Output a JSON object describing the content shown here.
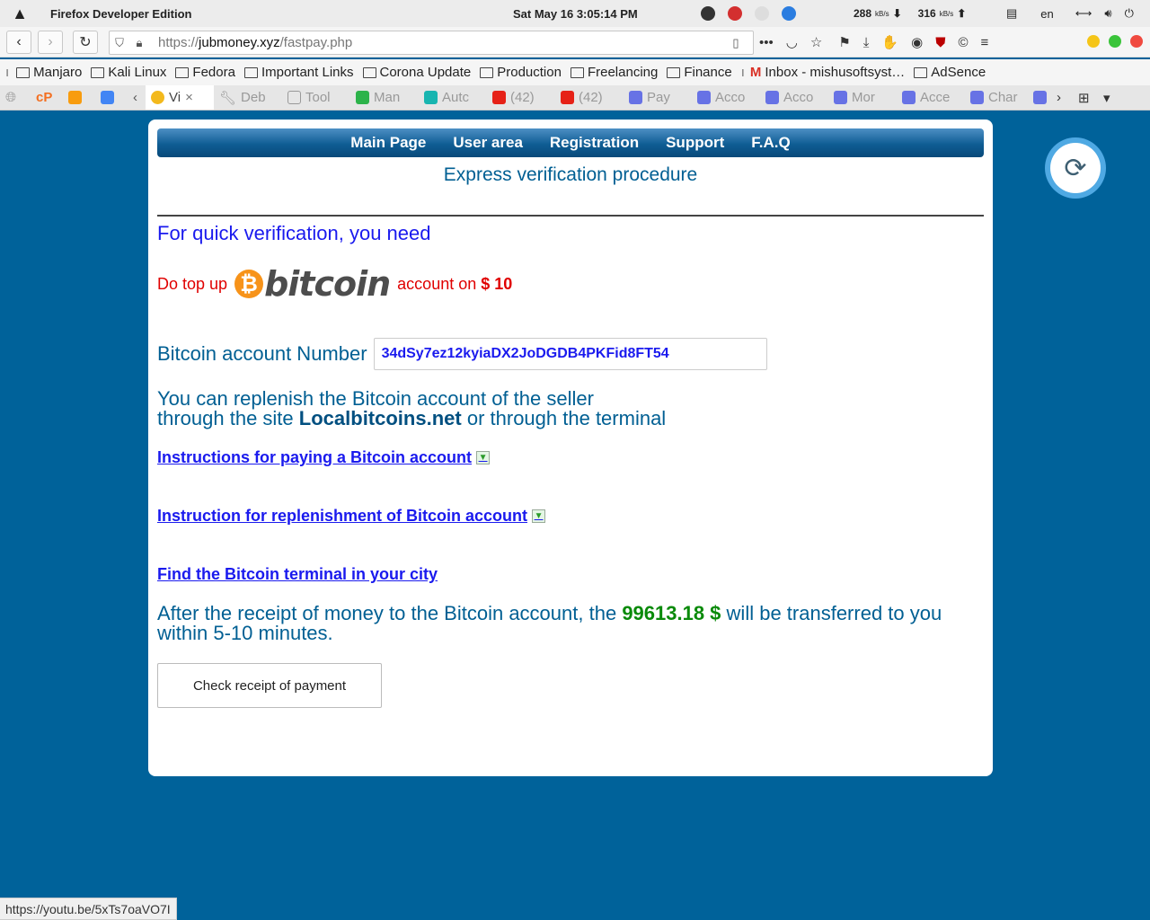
{
  "system_bar": {
    "app_name": "Firefox Developer Edition",
    "clock": "Sat May 16   3:05:14 PM",
    "net_down": "288",
    "net_down_unit": "kB/s",
    "net_up": "316",
    "net_up_unit": "kB/s",
    "language": "en"
  },
  "browser": {
    "url_scheme": "https://",
    "url_host": "jubmoney.xyz",
    "url_path": "/fastpay.php",
    "bookmarks": [
      "Manjaro",
      "Kali Linux",
      "Fedora",
      "Important Links",
      "Corona Update",
      "Production",
      "Freelancing",
      "Finance",
      "Inbox - mishusoftsyst…",
      "AdSence"
    ],
    "tabs": [
      {
        "label": "Vi",
        "color": "#f3b91d",
        "active": true
      },
      {
        "label": "Deb",
        "color": "#888888"
      },
      {
        "label": "Tool",
        "color": "#999999"
      },
      {
        "label": "Man",
        "color": "#2cb34a"
      },
      {
        "label": "Autc",
        "color": "#18b5b0"
      },
      {
        "label": "(42)",
        "color": "#e62117"
      },
      {
        "label": "(42)",
        "color": "#e62117"
      },
      {
        "label": "Pay",
        "color": "#6772e5"
      },
      {
        "label": "Acco",
        "color": "#6772e5"
      },
      {
        "label": "Acco",
        "color": "#6772e5"
      },
      {
        "label": "Mor",
        "color": "#6772e5"
      },
      {
        "label": "Acce",
        "color": "#6772e5"
      },
      {
        "label": "Char",
        "color": "#6772e5"
      }
    ],
    "status_url": "https://youtu.be/5xTs7oaVO7I"
  },
  "page": {
    "nav": [
      "Main Page",
      "User area",
      "Registration",
      "Support",
      "F.A.Q"
    ],
    "heading": "Express verification procedure",
    "intro": "For quick verification, you need",
    "topup_prefix": "Do top up",
    "btc_logo_text": "bitcoin",
    "topup_middle": "account on",
    "topup_amount": "$ 10",
    "account_label": "Bitcoin account Number",
    "account_number": "34dSy7ez12kyiaDX2JoDGDB4PKFid8FT54",
    "replenish_line1": "You can replenish the Bitcoin account of the seller",
    "replenish_prefix": "through the site",
    "replenish_site": "Localbitcoins.net",
    "replenish_suffix": "or through the terminal",
    "link_instructions_paying": "Instructions for paying a Bitcoin account",
    "link_instruction_replenish": "Instruction for replenishment of Bitcoin account",
    "link_find_terminal": "Find the Bitcoin terminal in your city",
    "after_prefix": "After the receipt of money to the Bitcoin account, the",
    "after_amount": "99613.18 $",
    "after_suffix": "will be transferred to you within 5-10 minutes.",
    "check_button": "Check receipt of payment"
  }
}
